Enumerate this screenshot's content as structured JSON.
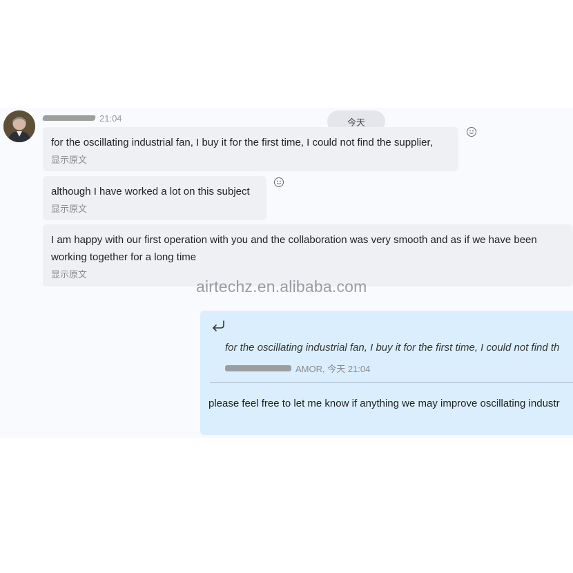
{
  "header": {
    "sender_time": "21:04",
    "date_divider": "今天"
  },
  "messages": [
    {
      "text": "for the oscillating industrial fan, I buy it for the first time, I could not find the supplier,",
      "translate_label": "显示原文"
    },
    {
      "text": "although I have worked a lot on this subject",
      "translate_label": "显示原文"
    },
    {
      "text": "I am happy with our first operation with you and the collaboration was very smooth and as if we have been working together for a long time",
      "translate_label": "显示原文"
    }
  ],
  "watermark": "airtechz.en.alibaba.com",
  "reply": {
    "quoted_text": "for the oscillating industrial fan, I buy it for the first time, I could not find th",
    "quoted_meta": "AMOR, 今天 21:04",
    "text": "please feel free to let me know if anything we may improve oscillating industr"
  },
  "icons": {
    "reaction": "smiley-face-icon",
    "reply": "reply-arrow-icon"
  },
  "colors": {
    "incoming_bubble": "#eef0f4",
    "outgoing_bubble": "#dbeefe",
    "date_pill": "#e4e6eb"
  }
}
